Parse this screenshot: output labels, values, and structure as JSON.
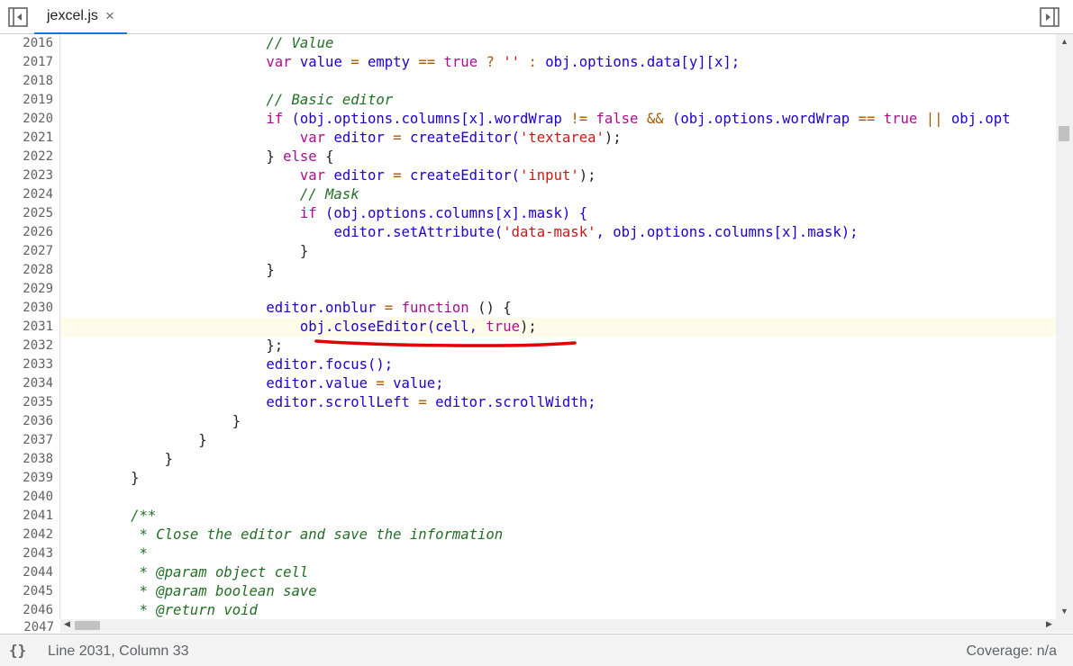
{
  "tab": {
    "filename": "jexcel.js",
    "close": "×"
  },
  "line_numbers": [
    "2016",
    "2017",
    "2018",
    "2019",
    "2020",
    "2021",
    "2022",
    "2023",
    "2024",
    "2025",
    "2026",
    "2027",
    "2028",
    "2029",
    "2030",
    "2031",
    "2032",
    "2033",
    "2034",
    "2035",
    "2036",
    "2037",
    "2038",
    "2039",
    "2040",
    "2041",
    "2042",
    "2043",
    "2044",
    "2045",
    "2046"
  ],
  "partial_line_number": "2047",
  "code": {
    "l2016": "// Value",
    "l2017": [
      "var",
      "value",
      "=",
      "empty",
      "==",
      "true",
      "?",
      "''",
      ":",
      "obj.options.data[y][x];"
    ],
    "l2019": "// Basic editor",
    "l2020": [
      "if",
      "(obj.options.columns[x].wordWrap",
      "!=",
      "false",
      "&&",
      "(obj.options.wordWrap",
      "==",
      "true",
      "||",
      "obj.opt"
    ],
    "l2021": [
      "var",
      "editor",
      "=",
      "createEditor(",
      "'textarea'",
      ");"
    ],
    "l2022": [
      "}",
      "else",
      "{"
    ],
    "l2023": [
      "var",
      "editor",
      "=",
      "createEditor(",
      "'input'",
      ");"
    ],
    "l2024": "// Mask",
    "l2025": [
      "if",
      "(obj.options.columns[x].mask) {"
    ],
    "l2026": [
      "editor.setAttribute(",
      "'data-mask'",
      ", obj.options.columns[x].mask);"
    ],
    "l2027": "}",
    "l2028": "}",
    "l2030": [
      "editor.onblur",
      "=",
      "function",
      "() {"
    ],
    "l2031": [
      "obj.closeEditor(cell, ",
      "true",
      ");"
    ],
    "l2032": "};",
    "l2033": "editor.focus();",
    "l2034": [
      "editor.value",
      "=",
      "value;"
    ],
    "l2035": [
      "editor.scrollLeft",
      "=",
      "editor.scrollWidth;"
    ],
    "l2036": "}",
    "l2037": "}",
    "l2038": "}",
    "l2039": "}",
    "l2041": "/**",
    "l2042": " * Close the editor and save the information",
    "l2043": " *",
    "l2044": " * @param object cell",
    "l2045": " * @param boolean save",
    "l2046": " * @return void"
  },
  "annotation": {
    "color": "#e00000",
    "target_line": "2031"
  },
  "status": {
    "braces": "{}",
    "position": "Line 2031, Column 33",
    "coverage": "Coverage: n/a"
  },
  "colors": {
    "keyword": "#aa0d91",
    "string": "#c41a16",
    "comment": "#236e25",
    "operator": "#a75800",
    "variable": "#1c00cf",
    "tab_accent": "#1a73e8",
    "active_line": "#fffbe9"
  }
}
